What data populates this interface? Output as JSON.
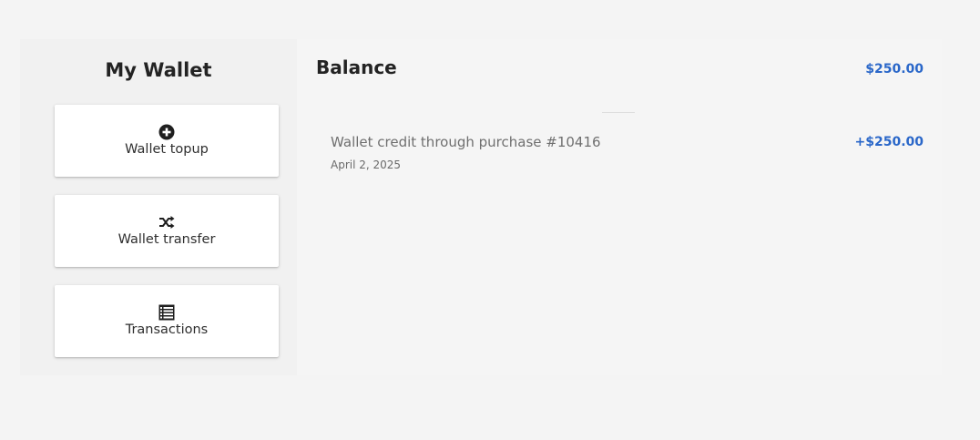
{
  "sidebar": {
    "title": "My Wallet",
    "items": [
      {
        "label": "Wallet topup",
        "icon": "plus-circle-icon"
      },
      {
        "label": "Wallet transfer",
        "icon": "shuffle-icon"
      },
      {
        "label": "Transactions",
        "icon": "list-icon"
      }
    ]
  },
  "main": {
    "title": "Balance",
    "balance": "$250.00",
    "transactions": [
      {
        "description": "Wallet credit through purchase #10416",
        "date": "April 2, 2025",
        "amount": "+$250.00"
      }
    ]
  },
  "colors": {
    "accent": "#2a67c9",
    "page_background": "#f4f4f4",
    "sidebar_background": "#f1f1f1",
    "card_background": "#ffffff"
  }
}
